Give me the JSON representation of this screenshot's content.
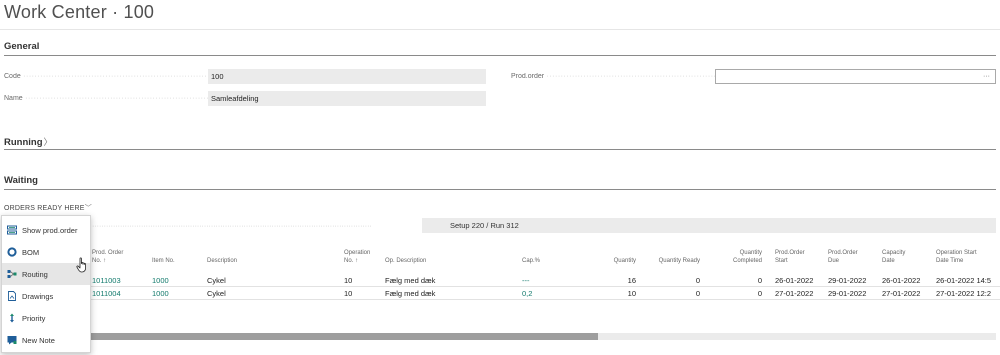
{
  "page": {
    "title": "Work Center · 100"
  },
  "general": {
    "heading": "General",
    "code_label": "Code",
    "code_value": "100",
    "name_label": "Name",
    "name_value": "Samleafdeling",
    "prod_order_label": "Prod.order",
    "prod_order_assist": "···"
  },
  "running": {
    "heading": "Running",
    "chevron": "〉"
  },
  "waiting": {
    "heading": "Waiting",
    "orders_label": "ORDERS READY HERE",
    "orders_chevron": "﹀",
    "setup_run": "Setup 220  /  Run 312"
  },
  "menu": {
    "items": [
      {
        "label": "Show prod.order",
        "icon": "show-prod-order-icon"
      },
      {
        "label": "BOM",
        "icon": "bom-icon"
      },
      {
        "label": "Routing",
        "icon": "routing-icon"
      },
      {
        "label": "Drawings",
        "icon": "drawings-icon"
      },
      {
        "label": "Priority",
        "icon": "priority-icon"
      },
      {
        "label": "New Note",
        "icon": "new-note-icon"
      }
    ]
  },
  "table": {
    "headers": {
      "prod_order_no": [
        "Prod. Order",
        "No. ↑"
      ],
      "item_no": "Item No.",
      "description": "Description",
      "operation_no": [
        "Operation",
        "No. ↑"
      ],
      "op_description": "Op. Description",
      "cap_pct": "Cap.%",
      "quantity": "Quantity",
      "quantity_ready": "Quantity Ready",
      "quantity_completed": [
        "Quantity",
        "Completed"
      ],
      "prod_order_start": [
        "Prod.Order",
        "Start"
      ],
      "prod_order_due": [
        "Prod.Order",
        "Due"
      ],
      "capacity_date": [
        "Capacity",
        "Date"
      ],
      "operation_start": [
        "Operation Start",
        "Date Time"
      ]
    },
    "rows": [
      {
        "prod_order_no": "1011003",
        "item_no": "1000",
        "description": "Cykel",
        "operation_no": "10",
        "op_description": "Fælg med dæk",
        "cap_pct": "---",
        "quantity": "16",
        "quantity_ready": "0",
        "quantity_completed": "0",
        "prod_order_start": "26-01-2022",
        "prod_order_due": "29-01-2022",
        "capacity_date": "26-01-2022",
        "operation_start": "26-01-2022 14:5"
      },
      {
        "prod_order_no": "1011004",
        "item_no": "1000",
        "description": "Cykel",
        "operation_no": "10",
        "op_description": "Fælg med dæk",
        "cap_pct": "0,2",
        "quantity": "10",
        "quantity_ready": "0",
        "quantity_completed": "0",
        "prod_order_start": "27-01-2022",
        "prod_order_due": "29-01-2022",
        "capacity_date": "27-01-2022",
        "operation_start": "27-01-2022 12:2"
      }
    ]
  },
  "colors": {
    "accent_link": "#127a6c",
    "field_bg": "#ebebeb",
    "menu_icon_blue": "#1f5e99",
    "menu_icon_green": "#1b8a6b"
  }
}
